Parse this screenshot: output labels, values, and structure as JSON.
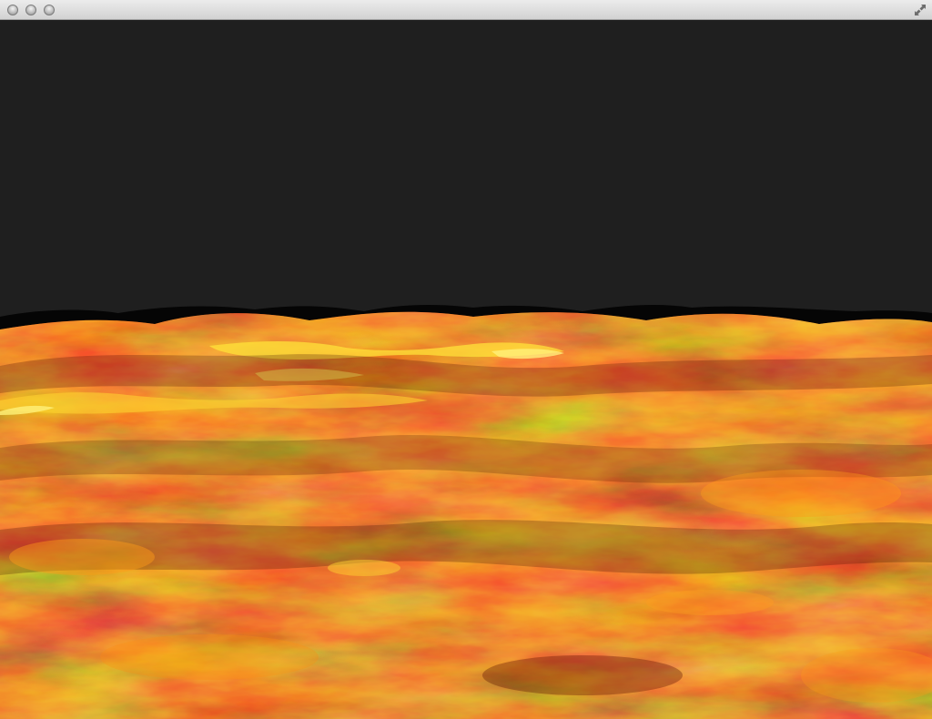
{
  "window": {
    "title": "",
    "controls": [
      "close",
      "minimize",
      "zoom"
    ],
    "fullscreen_icon": "fullscreen-arrows-icon"
  },
  "viewport": {
    "content": "lava-terrain-render",
    "colors": {
      "sky": "#1f1f1f",
      "horizon": "#000000",
      "lava_dark": "#5a0f04",
      "lava_mid": "#c63a07",
      "lava_bright": "#ff8a12",
      "lava_hot": "#ffe23a"
    }
  }
}
